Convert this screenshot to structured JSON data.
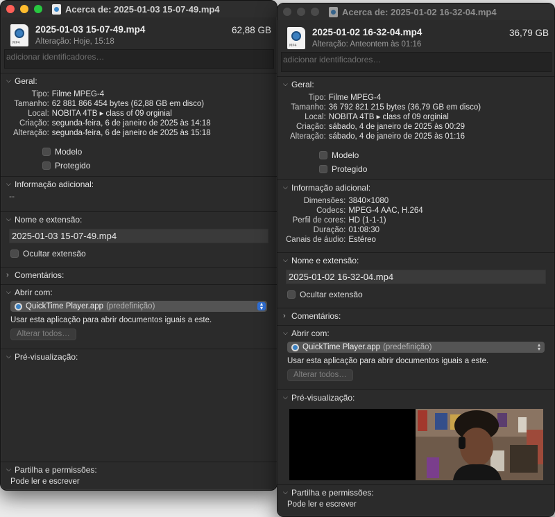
{
  "winA": {
    "title": "Acerca de: 2025-01-03 15-07-49.mp4",
    "name": "2025-01-03 15-07-49.mp4",
    "size": "62,88 GB",
    "modified_label": "Alteração:",
    "modified": "Hoje, 15:18",
    "tags_placeholder": "adicionar identificadores…",
    "general": {
      "header": "Geral:",
      "rows": [
        {
          "k": "Tipo:",
          "v": "Filme MPEG-4"
        },
        {
          "k": "Tamanho:",
          "v": "62 881 866 454 bytes (62,88 GB em disco)"
        },
        {
          "k": "Local:",
          "v": "NOBITA 4TB ▸ class of 09 orginial"
        },
        {
          "k": "Criação:",
          "v": "segunda-feira, 6 de janeiro de 2025 às 14:18"
        },
        {
          "k": "Alteração:",
          "v": "segunda-feira, 6 de janeiro de 2025 às 15:18"
        }
      ],
      "modelo": "Modelo",
      "protegido": "Protegido"
    },
    "more_info": {
      "header": "Informação adicional:",
      "value": "--"
    },
    "name_ext": {
      "header": "Nome e extensão:",
      "value": "2025-01-03 15-07-49.mp4",
      "hide_ext": "Ocultar extensão"
    },
    "comments": {
      "header": "Comentários:"
    },
    "open_with": {
      "header": "Abrir com:",
      "app": "QuickTime Player.app",
      "default": "(predefinição)",
      "note": "Usar esta aplicação para abrir documentos iguais a este.",
      "change_all": "Alterar todos…"
    },
    "preview": {
      "header": "Pré-visualização:"
    },
    "sharing": {
      "header": "Partilha e permissões:",
      "value": "Pode ler e escrever"
    }
  },
  "winB": {
    "title": "Acerca de: 2025-01-02 16-32-04.mp4",
    "name": "2025-01-02 16-32-04.mp4",
    "size": "36,79 GB",
    "modified_label": "Alteração:",
    "modified": "Anteontem às 01:16",
    "tags_placeholder": "adicionar identificadores…",
    "general": {
      "header": "Geral:",
      "rows": [
        {
          "k": "Tipo:",
          "v": "Filme MPEG-4"
        },
        {
          "k": "Tamanho:",
          "v": "36 792 821 215 bytes (36,79 GB em disco)"
        },
        {
          "k": "Local:",
          "v": "NOBITA 4TB ▸ class of 09 orginial"
        },
        {
          "k": "Criação:",
          "v": "sábado, 4 de janeiro de 2025 às 00:29"
        },
        {
          "k": "Alteração:",
          "v": "sábado, 4 de janeiro de 2025 às 01:16"
        }
      ],
      "modelo": "Modelo",
      "protegido": "Protegido"
    },
    "more_info": {
      "header": "Informação adicional:",
      "rows": [
        {
          "k": "Dimensões:",
          "v": "3840×1080"
        },
        {
          "k": "Codecs:",
          "v": "MPEG-4 AAC, H.264"
        },
        {
          "k": "Perfil de cores:",
          "v": "HD (1-1-1)"
        },
        {
          "k": "Duração:",
          "v": "01:08:30"
        },
        {
          "k": "Canais de áudio:",
          "v": "Estéreo"
        }
      ]
    },
    "name_ext": {
      "header": "Nome e extensão:",
      "value": "2025-01-02 16-32-04.mp4",
      "hide_ext": "Ocultar extensão"
    },
    "comments": {
      "header": "Comentários:"
    },
    "open_with": {
      "header": "Abrir com:",
      "app": "QuickTime Player.app",
      "default": "(predefinição)",
      "note": "Usar esta aplicação para abrir documentos iguais a este.",
      "change_all": "Alterar todos…"
    },
    "preview": {
      "header": "Pré-visualização:"
    },
    "sharing": {
      "header": "Partilha e permissões:",
      "value": "Pode ler e escrever"
    }
  },
  "colors": {
    "window_bg": "#2b2b2b",
    "close": "#ff5f57",
    "minimize": "#febc2e",
    "zoom": "#28c840",
    "inactive_light": "#4a4a4a",
    "accent": "#2f6fd6"
  }
}
